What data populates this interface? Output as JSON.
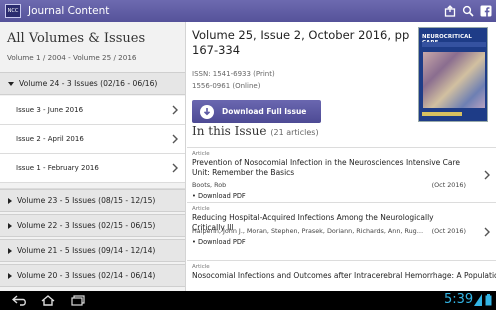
{
  "actionbar": {
    "logo_text": "NCC",
    "title": "Journal Content",
    "icons": [
      "share-icon",
      "search-icon",
      "facebook-icon"
    ]
  },
  "sidebar": {
    "title": "All Volumes & Issues",
    "range": "Volume 1 / 2004 - Volume 25 / 2016",
    "expanded_volume": "Volume 24 - 3 Issues (02/16 - 06/16)",
    "issues": [
      {
        "label": "Issue 3 - June 2016"
      },
      {
        "label": "Issue 2 - April 2016"
      },
      {
        "label": "Issue 1 - February 2016"
      }
    ],
    "volumes": [
      {
        "label": "Volume 23 - 5 Issues (08/15 - 12/15)"
      },
      {
        "label": "Volume 22 - 3 Issues (02/15 - 06/15)"
      },
      {
        "label": "Volume 21 - 5 Issues (09/14 - 12/14)"
      },
      {
        "label": "Volume 20 - 3 Issues (02/14 - 06/14)"
      }
    ]
  },
  "main": {
    "issue_heading": "Volume 25, Issue 2, October 2016, pp 167-334",
    "issn_print": "ISSN: 1541-6933 (Print)",
    "issn_online": "1556-0961 (Online)",
    "download_label": "Download Full Issue",
    "in_issue_label": "In this Issue",
    "article_count": "(21 articles)",
    "cover_title": "NEUROCRITICAL CARE",
    "articles": [
      {
        "type": "Article",
        "title": "Prevention of Nosocomial Infection in the Neurosciences Intensive Care Unit: Remember the Basics",
        "authors": "Boots, Rob",
        "date": "(Oct 2016)",
        "pdf": "Download PDF"
      },
      {
        "type": "Article",
        "title": "Reducing Hospital-Acquired Infections Among the Neurologically Critically Ill",
        "authors": "Halperin, John J., Moran, Stephen, Prasek, Doriann, Richards, Ann, Ruggiero, Charlene, Mau...",
        "date": "(Oct 2016)",
        "pdf": "Download PDF"
      },
      {
        "type": "Article",
        "title": "Nosocomial Infections and Outcomes after Intracerebral Hemorrhage: A Population-",
        "authors": "",
        "date": "",
        "pdf": ""
      }
    ]
  },
  "navbar": {
    "clock": "5:39",
    "icons": [
      "back-icon",
      "home-icon",
      "recents-icon"
    ]
  },
  "colors": {
    "actionbar": "#5f5ca5",
    "button": "#5a57a2",
    "clock": "#33b5e5"
  }
}
